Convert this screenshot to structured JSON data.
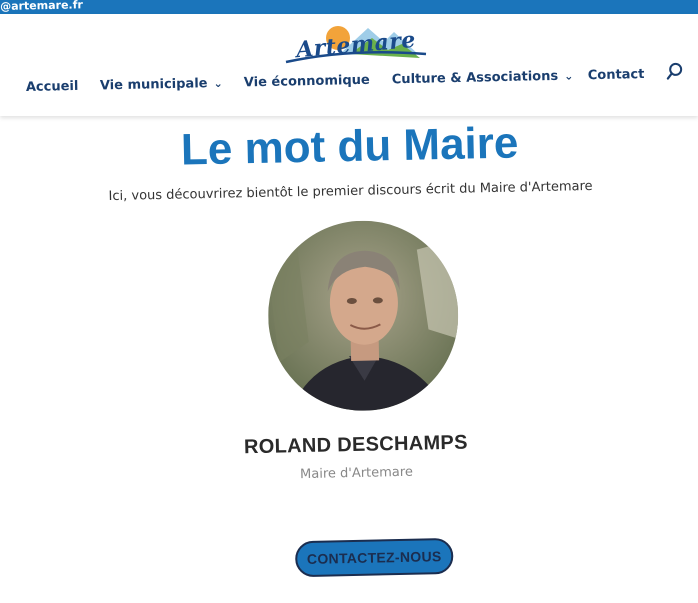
{
  "topbar": {
    "email": "@artemare.fr"
  },
  "logo": {
    "text": "Artemare"
  },
  "nav": {
    "items": [
      {
        "label": "Accueil",
        "dropdown": false
      },
      {
        "label": "Vie municipale",
        "dropdown": true
      },
      {
        "label": "Vie éconnomique",
        "dropdown": false
      },
      {
        "label": "Culture & Associations",
        "dropdown": true
      },
      {
        "label": "Contact",
        "dropdown": false
      }
    ],
    "search_icon": "search-icon"
  },
  "main": {
    "title": "Le mot du Maire",
    "intro": "Ici, vous découvrirez bientôt le premier discours écrit du Maire d'Artemare",
    "person": {
      "name": "ROLAND DESCHAMPS",
      "role": "Maire d'Artemare"
    },
    "cta": "CONTACTEZ-NOUS"
  },
  "colors": {
    "brand_blue": "#1b75bb",
    "nav_text": "#1a3e6e",
    "button_border": "#1b2d4f"
  }
}
